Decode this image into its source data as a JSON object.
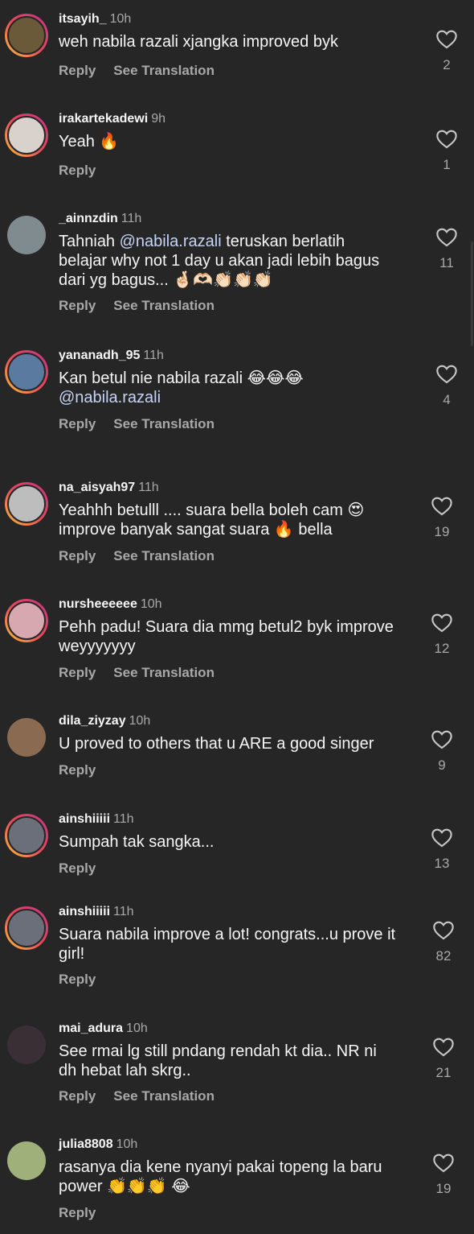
{
  "comments": [
    {
      "user": "itsayih_",
      "time": "10h",
      "text": "weh nabila razali xjangka improved byk",
      "likes": "2",
      "reply": "Reply",
      "translate": "See Translation",
      "avatar_color": "#6b5a3a"
    },
    {
      "user": "irakartekadewi",
      "time": "9h",
      "text": "Yeah 🔥",
      "likes": "1",
      "reply": "Reply",
      "translate": "",
      "avatar_color": "#d9d2cc"
    },
    {
      "user": "_ainnzdin",
      "time": "11h",
      "text_pre": "Tahniah ",
      "mention": "@nabila.razali",
      "text_post": "  teruskan berlatih\nbelajar why not 1 day u akan jadi lebih bagus\ndari yg bagus... 🤞🏻🫶🏻👏🏻👏🏻👏🏻",
      "likes": "11",
      "reply": "Reply",
      "translate": "See Translation",
      "avatar_color": "#7f8b8f"
    },
    {
      "user": "yananadh_95",
      "time": "11h",
      "text": "Kan betul nie nabila razali 😂😂😂",
      "mention2": "@nabila.razali",
      "likes": "4",
      "reply": "Reply",
      "translate": "See Translation",
      "avatar_color": "#5a7aa0"
    },
    {
      "user": "na_aisyah97",
      "time": "11h",
      "text": "Yeahhh betulll .... suara bella boleh cam 😍\nimprove banyak sangat suara 🔥 bella",
      "likes": "19",
      "reply": "Reply",
      "translate": "See Translation",
      "avatar_color": "#bdbdbd"
    },
    {
      "user": "nursheeeeee",
      "time": "10h",
      "text": "Pehh padu! Suara dia mmg betul2 byk improve\nweyyyyyyy",
      "likes": "12",
      "reply": "Reply",
      "translate": "See Translation",
      "avatar_color": "#d8a8b0"
    },
    {
      "user": "dila_ziyzay",
      "time": "10h",
      "text": "U proved to others that u ARE a good singer",
      "likes": "9",
      "reply": "Reply",
      "translate": "",
      "avatar_color": "#8a6a50"
    },
    {
      "user": "ainshiiiii",
      "time": "11h",
      "text": "Sumpah tak sangka...",
      "likes": "13",
      "reply": "Reply",
      "translate": "",
      "avatar_color": "#6a6f7a"
    },
    {
      "user": "ainshiiiii",
      "time": "11h",
      "text": "Suara nabila improve a lot! congrats...u prove it\ngirl!",
      "likes": "82",
      "reply": "Reply",
      "translate": "",
      "avatar_color": "#6a6f7a"
    },
    {
      "user": "mai_adura",
      "time": "10h",
      "text": "See rmai lg still pndang rendah kt dia.. NR ni\ndh hebat lah skrg..",
      "likes": "21",
      "reply": "Reply",
      "translate": "See Translation",
      "avatar_color": "#3a2f35"
    },
    {
      "user": "julia8808",
      "time": "10h",
      "text": "rasanya dia kene nyanyi pakai topeng la baru\npower 👏👏👏 😂",
      "likes": "19",
      "reply": "Reply",
      "translate": "",
      "avatar_color": "#9fb07a"
    }
  ]
}
